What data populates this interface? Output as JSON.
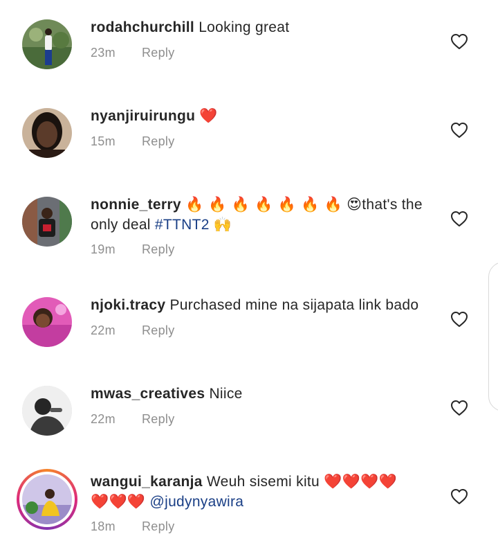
{
  "comments": [
    {
      "username": "rodahchurchill",
      "text": "Looking great",
      "time": "23m",
      "reply": "Reply"
    },
    {
      "username": "nyanjiruirungu",
      "emoji": "❤️",
      "time": "15m",
      "reply": "Reply"
    },
    {
      "username": "nonnie_terry",
      "fires": "🔥 🔥 🔥 🔥 🔥 🔥 🔥",
      "heart_eyes": "😍",
      "text_line1": "that's the",
      "text_line2": "only deal",
      "hashtag": "#TTNT2",
      "hands": "🙌",
      "time": "19m",
      "reply": "Reply"
    },
    {
      "username": "njoki.tracy",
      "text": "Purchased mine na sijapata link bado",
      "time": "22m",
      "reply": "Reply"
    },
    {
      "username": "mwas_creatives",
      "text": "Niice",
      "time": "22m",
      "reply": "Reply"
    },
    {
      "username": "wangui_karanja",
      "text": "Weuh sisemi kitu",
      "hearts_line1": "❤️❤️❤️❤️",
      "hearts_line2": "❤️❤️❤️",
      "mention": "@judynyawira",
      "time": "18m",
      "reply": "Reply"
    }
  ],
  "icons": {
    "like": "heart-outline-icon",
    "avatar": "profile-photo"
  },
  "colors": {
    "username": "#262626",
    "meta": "#8e8e8e",
    "link": "#1a3f86",
    "heart": "#e0202c",
    "story_ring": "#dd2a7b"
  }
}
